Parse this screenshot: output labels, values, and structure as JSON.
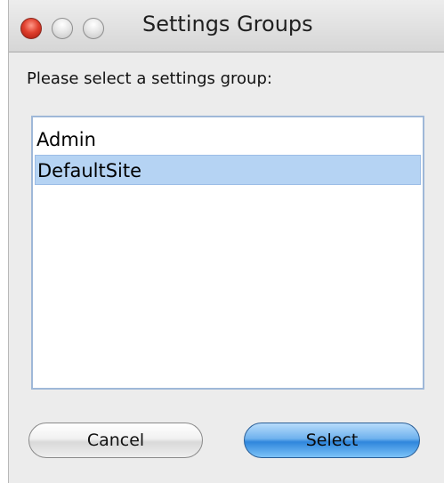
{
  "window": {
    "title": "Settings Groups"
  },
  "dialog": {
    "prompt": "Please select a settings group:",
    "list": {
      "items": [
        {
          "label": "Admin",
          "selected": false
        },
        {
          "label": "DefaultSite",
          "selected": true
        }
      ]
    },
    "buttons": {
      "cancel_label": "Cancel",
      "select_label": "Select"
    }
  },
  "colors": {
    "selection": "#b5d3f3",
    "default_button": "#4a9ee8",
    "close_button": "#e0402e"
  }
}
